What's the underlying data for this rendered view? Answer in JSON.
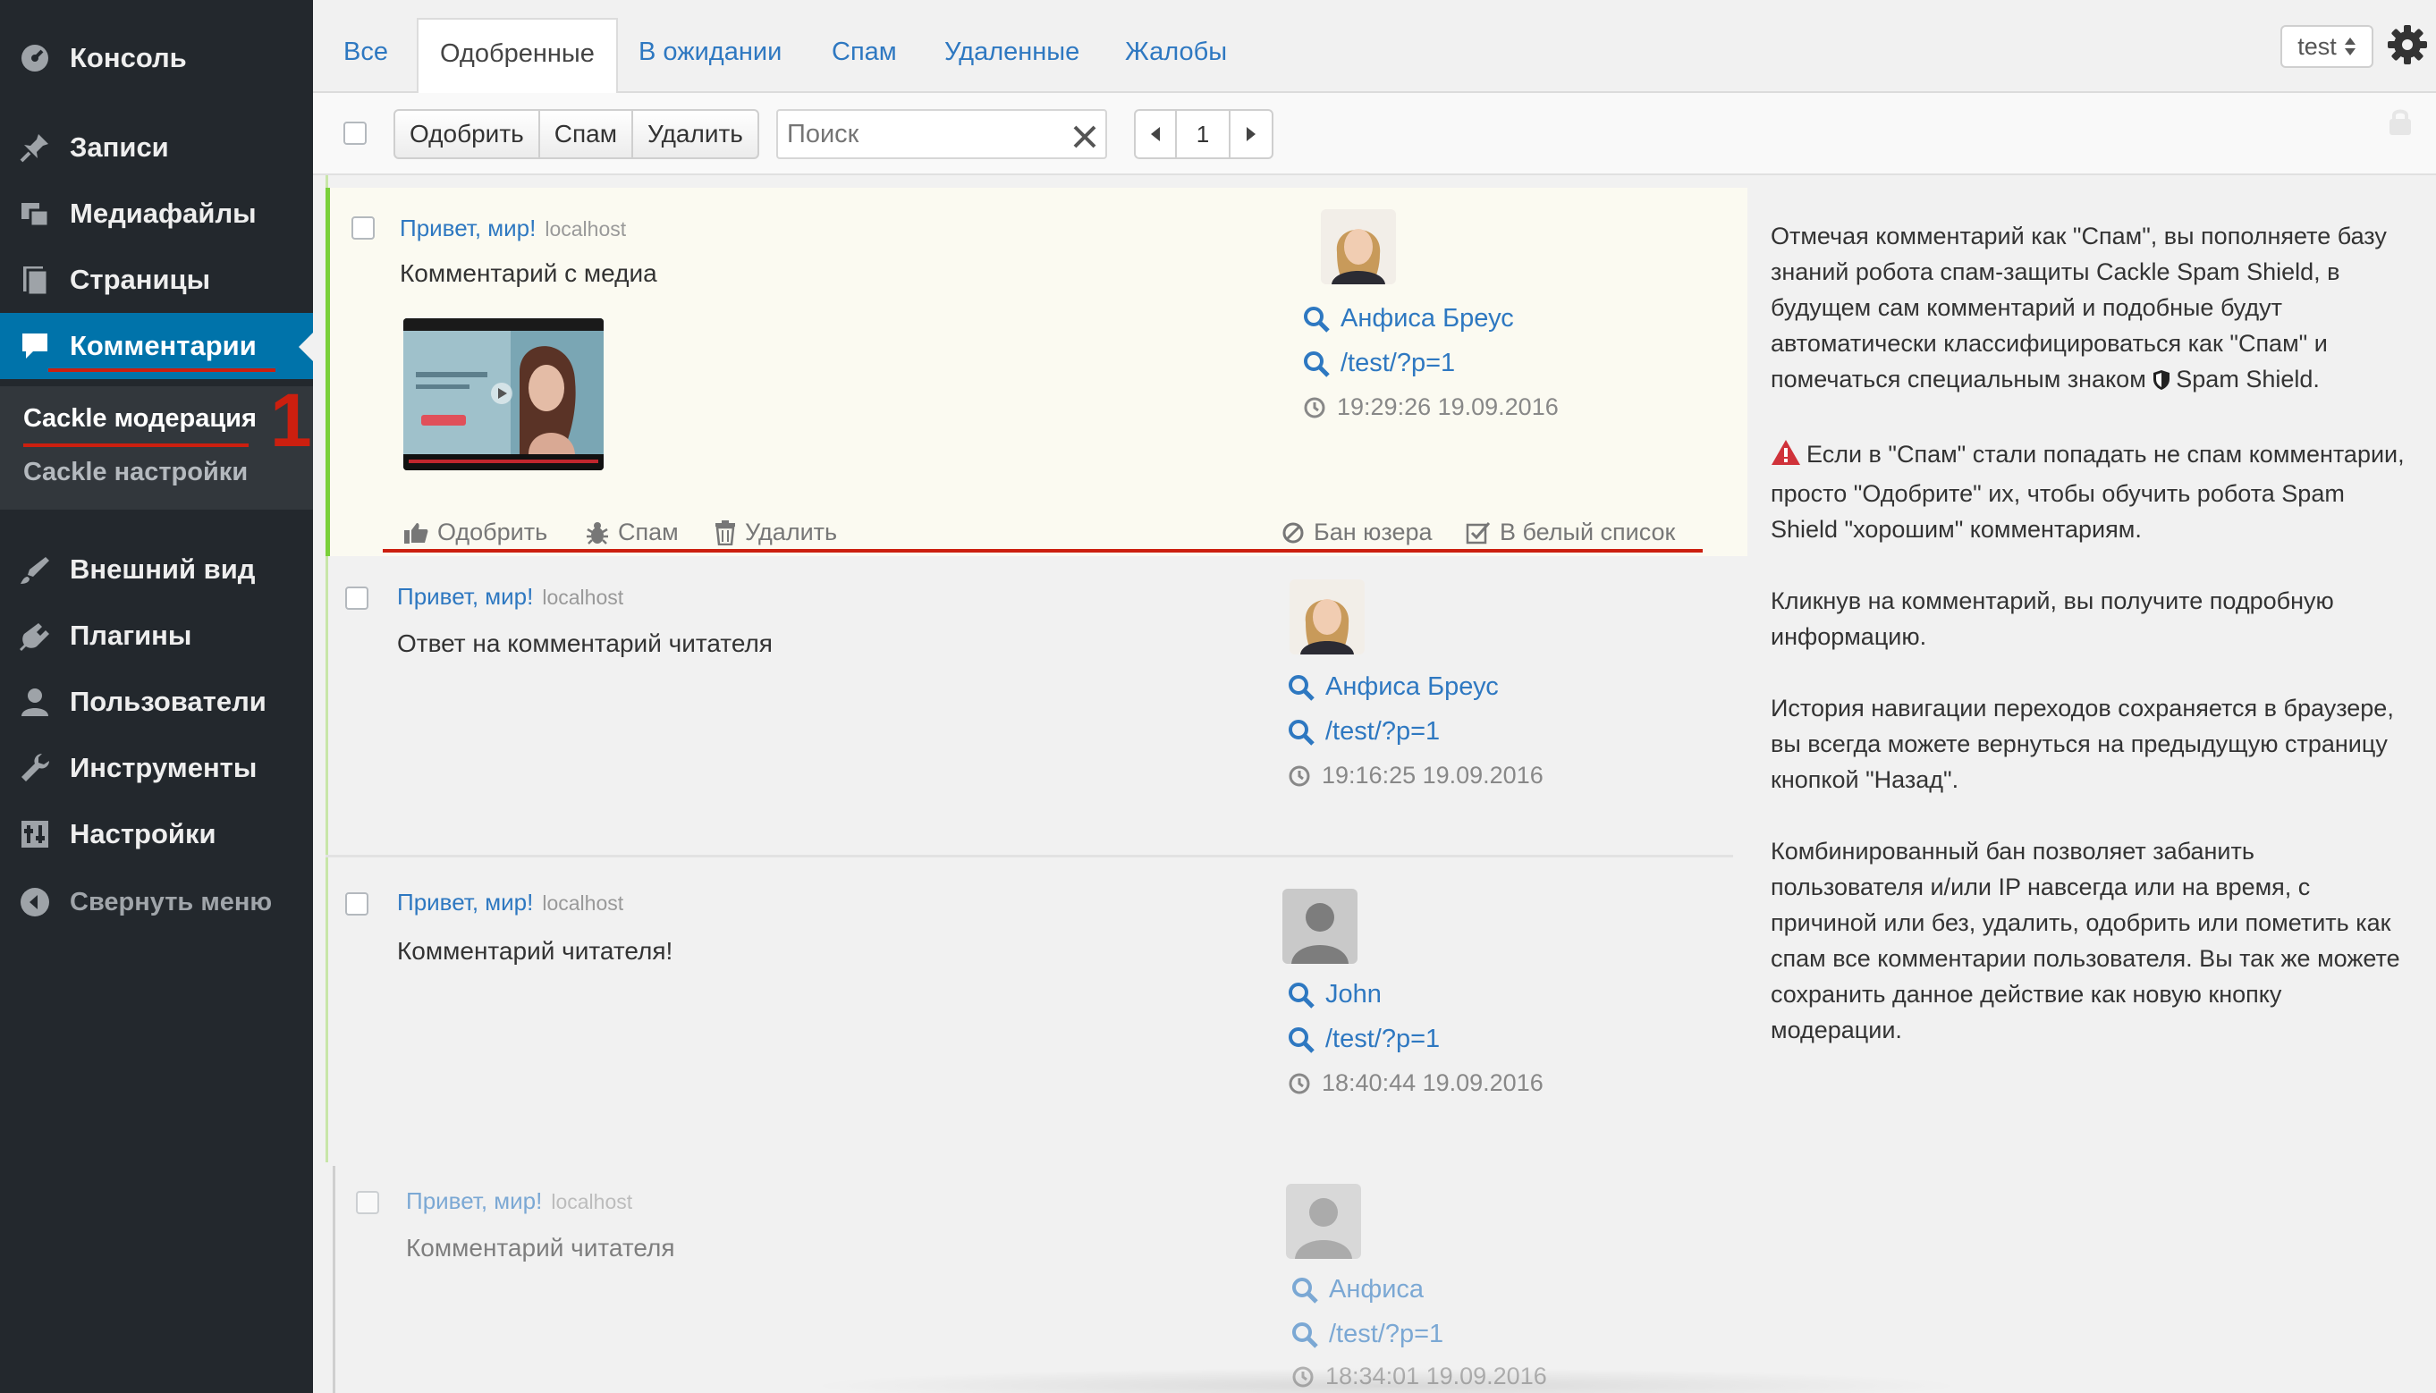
{
  "sidebar": {
    "items": [
      {
        "label": "Консоль",
        "icon": "dashboard-icon"
      },
      {
        "label": "Записи",
        "icon": "pin-icon"
      },
      {
        "label": "Медиафайлы",
        "icon": "media-icon"
      },
      {
        "label": "Страницы",
        "icon": "pages-icon"
      },
      {
        "label": "Комментарии",
        "icon": "comments-icon"
      },
      {
        "label": "Внешний вид",
        "icon": "appearance-icon"
      },
      {
        "label": "Плагины",
        "icon": "plugins-icon"
      },
      {
        "label": "Пользователи",
        "icon": "users-icon"
      },
      {
        "label": "Инструменты",
        "icon": "tools-icon"
      },
      {
        "label": "Настройки",
        "icon": "settings-icon"
      }
    ],
    "submenu": [
      {
        "label": "Cackle модерация"
      },
      {
        "label": "Cackle настройки"
      }
    ],
    "collapse_label": "Свернуть меню",
    "annotation_number": "1",
    "accent_color": "#0073aa",
    "annotation_color": "#cc1f0f"
  },
  "tabs": [
    "Все",
    "Одобренные",
    "В ожидании",
    "Спам",
    "Удаленные",
    "Жалобы"
  ],
  "user_select": {
    "value": "test"
  },
  "toolbar": {
    "approve_label": "Одобрить",
    "spam_label": "Спам",
    "delete_label": "Удалить",
    "search_placeholder": "Поиск",
    "page": "1"
  },
  "comments": [
    {
      "post_title": "Привет, мир!",
      "host": "localhost",
      "text": "Комментарий с медиа",
      "author": "Анфиса Бреус",
      "url": "/test/?p=1",
      "time": "19:29:26 19.09.2016",
      "actions": {
        "approve": "Одобрить",
        "spam": "Спам",
        "delete": "Удалить",
        "ban": "Бан юзера",
        "whitelist": "В белый список"
      }
    },
    {
      "post_title": "Привет, мир!",
      "host": "localhost",
      "text": "Ответ на комментарий читателя",
      "author": "Анфиса Бреус",
      "url": "/test/?p=1",
      "time": "19:16:25 19.09.2016"
    },
    {
      "post_title": "Привет, мир!",
      "host": "localhost",
      "text": "Комментарий читателя!",
      "author": "John",
      "url": "/test/?p=1",
      "time": "18:40:44 19.09.2016"
    },
    {
      "post_title": "Привет, мир!",
      "host": "localhost",
      "text": "Комментарий читателя",
      "author": "Анфиса",
      "url": "/test/?p=1",
      "time": "18:34:01 19.09.2016"
    }
  ],
  "help": {
    "p1": "Отмечая комментарий как \"Спам\", вы пополняете базу знаний робота спам-защиты Cackle Spam Shield, в будущем сам комментарий и подобные будут автоматически классифицироваться как \"Спам\" и помечаться специальным знаком",
    "p1_badge": "Spam Shield.",
    "p2": "Если в \"Спам\" стали попадать не спам комментарии, просто \"Одобрите\" их, чтобы обучить робота Spam Shield \"хорошим\" комментариям.",
    "p3": "Кликнув на комментарий, вы получите подробную информацию.",
    "p4": "История навигации переходов сохраняется в браузере, вы всегда можете вернуться на предыдущую страницу кнопкой \"Назад\".",
    "p5": "Комбинированный бан позволяет забанить пользователя и/или IP навсегда или на время, с причиной или без, удалить, одобрить или пометить как спам все комментарии пользователя. Вы так же можете сохранить данное действие как новую кнопку модерации."
  }
}
